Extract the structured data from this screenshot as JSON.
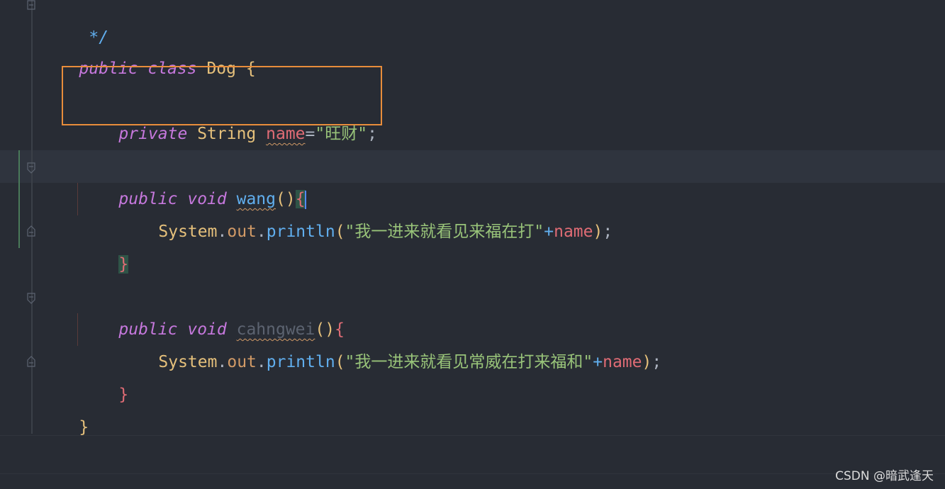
{
  "code": {
    "comment_end": "*/",
    "class_decl": {
      "kw_public": "public",
      "kw_class": "class",
      "class_name": "Dog",
      "open_brace": "{"
    },
    "field_decl": {
      "kw_private": "private",
      "type": "String",
      "name": "name",
      "assign": "=",
      "value": "\"旺财\"",
      "semicolon": ";"
    },
    "method_wang": {
      "kw_public": "public",
      "kw_void": "void",
      "name": "wang",
      "parens": "()",
      "open_brace": "{",
      "body": {
        "obj": "System",
        "dot1": ".",
        "out": "out",
        "dot2": ".",
        "call": "println",
        "open": "(",
        "str": "\"我一进来就看见来福在打\"",
        "plus": "+",
        "arg": "name",
        "close": ")",
        "semicolon": ";"
      },
      "close_brace": "}"
    },
    "method_cahngwei": {
      "kw_public": "public",
      "kw_void": "void",
      "name": "cahngwei",
      "parens": "()",
      "open_brace": "{",
      "body": {
        "obj": "System",
        "dot1": ".",
        "out": "out",
        "dot2": ".",
        "call": "println",
        "open": "(",
        "str": "\"我一进来就看见常威在打来福和\"",
        "plus": "+",
        "arg": "name",
        "close": ")",
        "semicolon": ";"
      },
      "close_brace": "}"
    },
    "class_close_brace": "}"
  },
  "watermark": "CSDN @暗武逢天",
  "colors": {
    "background": "#282c34",
    "keyword": "#c678dd",
    "type": "#e5c07b",
    "field": "#e06c75",
    "string": "#98c379",
    "function": "#61afef",
    "highlight_box": "#e88d3b"
  }
}
